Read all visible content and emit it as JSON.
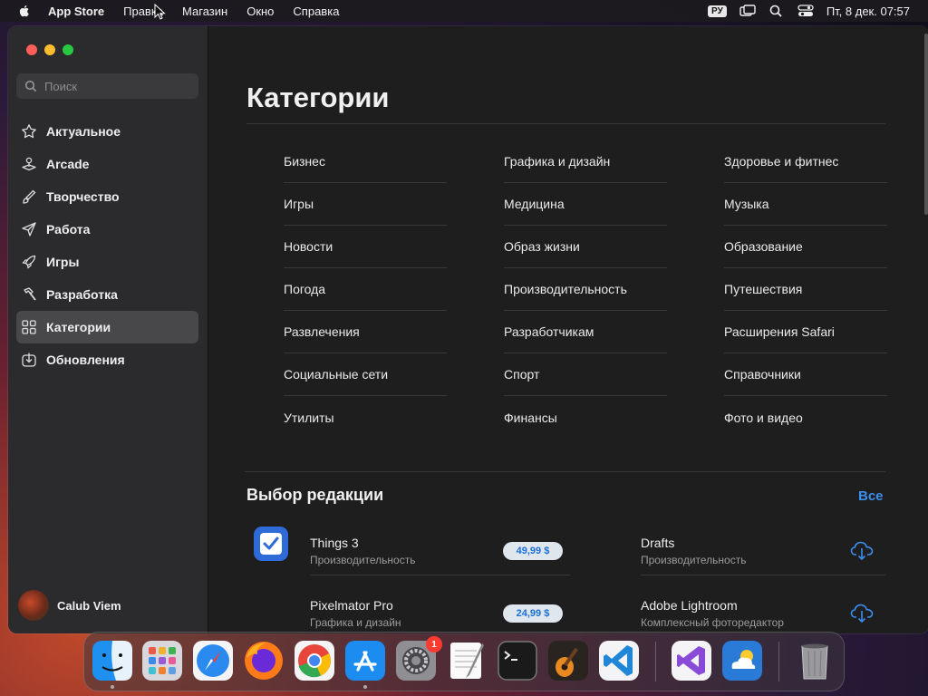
{
  "menubar": {
    "app_name": "App Store",
    "menus": [
      "Правка",
      "Магазин",
      "Окно",
      "Справка"
    ],
    "input_source": "РУ",
    "clock": "Пт, 8 дек.  07:57"
  },
  "sidebar": {
    "search_placeholder": "Поиск",
    "items": [
      {
        "label": "Актуальное",
        "icon": "star-icon"
      },
      {
        "label": "Arcade",
        "icon": "joystick-icon"
      },
      {
        "label": "Творчество",
        "icon": "brush-icon"
      },
      {
        "label": "Работа",
        "icon": "paper-plane-icon"
      },
      {
        "label": "Игры",
        "icon": "rocket-icon"
      },
      {
        "label": "Разработка",
        "icon": "hammer-icon"
      },
      {
        "label": "Категории",
        "icon": "grid-icon",
        "active": true
      },
      {
        "label": "Обновления",
        "icon": "download-icon"
      }
    ],
    "user_name": "Calub Viem"
  },
  "main": {
    "title": "Категории",
    "categories": [
      [
        "Бизнес",
        "Игры",
        "Новости",
        "Погода",
        "Развлечения",
        "Социальные сети",
        "Утилиты"
      ],
      [
        "Графика и дизайн",
        "Медицина",
        "Образ жизни",
        "Производительность",
        "Разработчикам",
        "Спорт",
        "Финансы"
      ],
      [
        "Здоровье и фитнес",
        "Музыка",
        "Образование",
        "Путешествия",
        "Расширения Safari",
        "Справочники",
        "Фото и видео"
      ]
    ],
    "editors_choice": {
      "title": "Выбор редакции",
      "see_all": "Все",
      "apps": [
        {
          "name": "Things 3",
          "category": "Производительность",
          "price": "49,99 $"
        },
        {
          "name": "Drafts",
          "category": "Производительность",
          "action": "download"
        },
        {
          "name": "Pixelmator Pro",
          "category": "Графика и дизайн",
          "price": "24,99 $"
        },
        {
          "name": "Adobe Lightroom",
          "category": "Комплексный фоторедактор",
          "action": "download"
        }
      ]
    }
  },
  "dock": {
    "apps": [
      "Finder",
      "Launchpad",
      "Safari",
      "Firefox",
      "Chrome",
      "App Store",
      "System Settings",
      "TextEdit",
      "Terminal",
      "GarageBand",
      "VS Code",
      "Visual Studio",
      "Weather",
      "Trash"
    ],
    "settings_badge": "1"
  },
  "colors": {
    "accent": "#3b8ef0",
    "sidebar_bg": "#2b2a2c",
    "main_bg": "#1e1e1e"
  }
}
